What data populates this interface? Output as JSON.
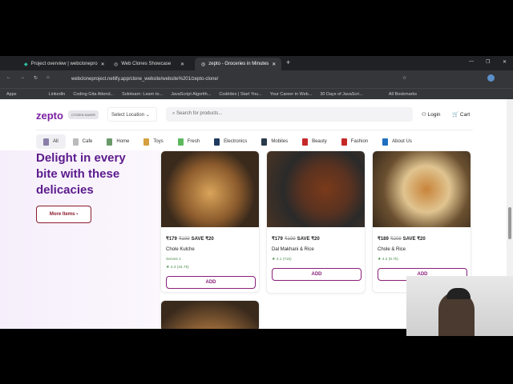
{
  "browser": {
    "tabs": [
      {
        "title": "Project overview | webclonepro"
      },
      {
        "title": "Web Clones Showcase"
      },
      {
        "title": "zepto - Groceries in Minutes"
      }
    ],
    "url": "webcloneproject.netlify.app/clone_website/website%201/zepto-clone/",
    "bookmarks": [
      "Apps",
      "LinkedIn",
      "Coding Gita Attend...",
      "Sololearn: Learn to...",
      "JavaScript Algorith...",
      "Codédex | Start You...",
      "Your Career in Web...",
      "30 Days of JavaScri...",
      "All Bookmarks"
    ]
  },
  "header": {
    "logo": "zepto",
    "badge": "CITIZEN SAVER",
    "location": "Select Location ⌄",
    "search_placeholder": "Search for products...",
    "login": "Login",
    "cart": "Cart"
  },
  "categories": [
    {
      "label": "All",
      "color": "#8a7fa8"
    },
    {
      "label": "Cafe",
      "color": "#bbb"
    },
    {
      "label": "Home",
      "color": "#6a9a6a"
    },
    {
      "label": "Toys",
      "color": "#d4a040"
    },
    {
      "label": "Fresh",
      "color": "#5cb85c"
    },
    {
      "label": "Electronics",
      "color": "#1f3a5f"
    },
    {
      "label": "Mobiles",
      "color": "#2a3a4a"
    },
    {
      "label": "Beauty",
      "color": "#c62828"
    },
    {
      "label": "Fashion",
      "color": "#c62828"
    },
    {
      "label": "About Us",
      "color": "#1e6fc0"
    }
  ],
  "hero": {
    "title": "Delight in every bite with these delicacies",
    "button": "More Items ›"
  },
  "products": [
    {
      "price": "₹179",
      "mrp": "₹199",
      "save": "SAVE ₹20",
      "name": "Chole Kulche",
      "serves": "Serves 1",
      "rating": "★ 4.3 (44.7k)",
      "add": "ADD"
    },
    {
      "price": "₹179",
      "mrp": "₹199",
      "save": "SAVE ₹20",
      "name": "Dal Makhani & Rice",
      "rating": "★ 4.1 (71k)",
      "add": "ADD"
    },
    {
      "price": "₹189",
      "mrp": "₹209",
      "save": "SAVE ₹20",
      "name": "Chole & Rice",
      "rating": "★ 4.2 (8.7k)",
      "add": "ADD"
    }
  ]
}
